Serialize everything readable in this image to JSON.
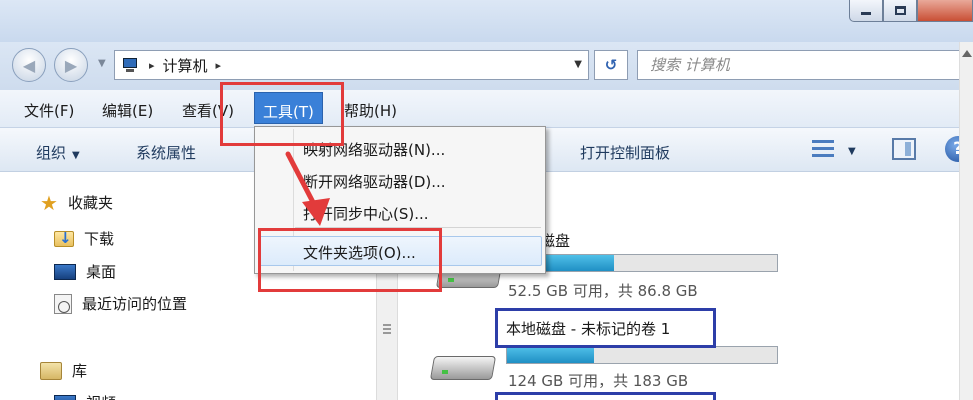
{
  "window": {
    "minimize_label": "",
    "maximize_label": ""
  },
  "address": {
    "crumb": "计算机",
    "sep": "▸"
  },
  "search": {
    "placeholder": "搜索 计算机"
  },
  "menubar": {
    "items": [
      {
        "label": "文件(F)"
      },
      {
        "label": "编辑(E)"
      },
      {
        "label": "查看(V)"
      },
      {
        "label": "工具(T)",
        "active": true
      },
      {
        "label": "帮助(H)"
      }
    ]
  },
  "toolbar": {
    "organize": "组织",
    "system_properties": "系统属性",
    "open_control_panel": "打开控制面板"
  },
  "nav": {
    "favorites": "收藏夹",
    "downloads": "下载",
    "desktop": "桌面",
    "recent": "最近访问的位置",
    "library": "库",
    "videos": "视频"
  },
  "tools_menu": {
    "map_drive": "映射网络驱动器(N)...",
    "disconnect_drive": "断开网络驱动器(D)...",
    "sync_center": "打开同步中心(S)...",
    "folder_options": "文件夹选项(O)..."
  },
  "drives": [
    {
      "name": "磁盘",
      "info": "52.5 GB 可用，共 86.8 GB",
      "used_fraction": 0.395
    },
    {
      "name": "本地磁盘 - 未标记的卷 1",
      "info": "124 GB 可用，共 183 GB",
      "used_fraction": 0.322
    }
  ],
  "colors": {
    "menu_active": "#3a80d8",
    "highlight_red": "#e23b3b",
    "highlight_blue": "#2d3ea8",
    "drive_fill": "#1f8fc4"
  }
}
